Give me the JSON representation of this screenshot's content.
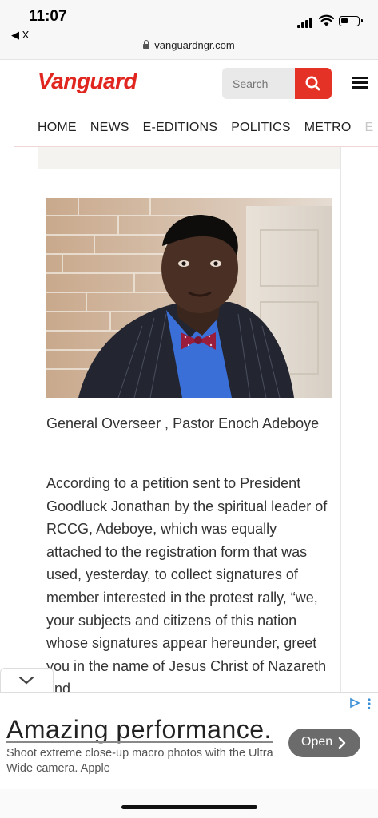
{
  "status_bar": {
    "time": "11:07",
    "back_app": "◀ X",
    "url": "vanguardngr.com"
  },
  "header": {
    "logo": "Vanguard",
    "search_placeholder": "Search",
    "brand_color": "#e0261f"
  },
  "nav": {
    "items": [
      "HOME",
      "NEWS",
      "E-EDITIONS",
      "POLITICS",
      "METRO",
      "E"
    ]
  },
  "article": {
    "caption": "General Overseer , Pastor Enoch Adeboye",
    "body": "According to a petition sent to President Goodluck Jonathan by the spiritual leader of RCCG, Adeboye, which was equally attached to the registration form that was used, yesterday, to collect signatures of member interested in the protest rally, “we, your subjects and citizens of this nation whose signatures appear hereunder, greet you in the name of Jesus Christ of Nazareth and"
  },
  "ad": {
    "headline": "Amazing performance.",
    "description": "Shoot extreme close-up macro photos with the Ultra Wide camera. Apple",
    "button_label": "Open"
  }
}
